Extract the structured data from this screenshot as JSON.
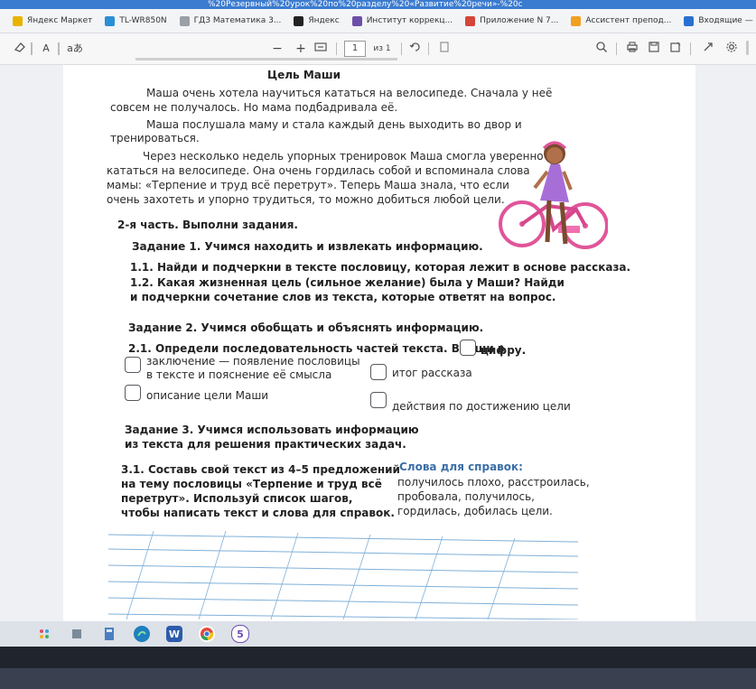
{
  "browser": {
    "url_fragment": "%20Резервный%20урок%20по%20разделу%20«Развитие%20речи»-%20с",
    "bookmarks": [
      {
        "label": "Яндекс Маркет",
        "color": "#e8b400"
      },
      {
        "label": "TL-WR850N",
        "color": "#2a8fd6"
      },
      {
        "label": "ГДЗ Математика 3...",
        "color": "#9aa0a6"
      },
      {
        "label": "Яндекс",
        "color": "#222222"
      },
      {
        "label": "Институт коррекц...",
        "color": "#6b4fa8"
      },
      {
        "label": "Приложение N 7...",
        "color": "#d4453a"
      },
      {
        "label": "Ассистент препод...",
        "color": "#f0a020"
      },
      {
        "label": "Входящие — Рам...",
        "color": "#2b6fd0"
      }
    ]
  },
  "pdf_toolbar": {
    "erase_icon": "eraser-icon",
    "text_size": "A",
    "read_aloud": "aあ",
    "zoom_out": "−",
    "zoom_in": "+",
    "page_current": "1",
    "page_total": "из 1"
  },
  "document": {
    "title": "Цель Маши",
    "p1_l1": "Маша очень хотела научиться кататься на велосипеде. Сначала у неё",
    "p1_l2": "совсем не получалось. Но мама подбадривала её.",
    "p2_l1": "Маша послушала маму и стала каждый день выходить во двор и",
    "p2_l2": "тренироваться.",
    "p3_l1": "Через несколько недель упорных тренировок Маша смогла уверенно",
    "p3_l2": "кататься на велосипеде. Она очень гордилась собой и вспоминала слова",
    "p3_l3": "мамы: «Терпение и труд всё перетрут». Теперь Маша знала, что если",
    "p3_l4": "очень захотеть и упорно трудиться, то можно добиться любой цели.",
    "part2": "2-я часть. Выполни задания.",
    "task1": "Задание 1. Учимся находить и извлекать информацию.",
    "t11": "1.1. Найди и подчеркни в тексте пословицу, которая лежит в основе рассказа.",
    "t12_l1": "1.2. Какая жизненная цель (сильное желание) была у Маши? Найди",
    "t12_l2": "и подчеркни сочетание слов из текста, которые ответят на вопрос.",
    "task2": "Задание 2. Учимся обобщать и объяснять информацию.",
    "t21_a": "2.1. Определи последовательность частей текста. Впиши в",
    "t21_b": "цифру.",
    "opt1_l1": "заключение — появление пословицы",
    "opt1_l2": "в тексте и пояснение её смысла",
    "opt2": "итог рассказа",
    "opt3": "описание цели Маши",
    "opt4": "действия по достижению цели",
    "task3_l1": "Задание 3. Учимся использовать информацию",
    "task3_l2": "из текста для решения практических задач.",
    "t31_l1": "3.1. Составь свой текст из 4–5 предложений",
    "t31_l2": "на тему пословицы «Терпение и труд всё",
    "t31_l3": "перетрут». Используй список шагов,",
    "t31_l4": "чтобы написать текст и слова для справок.",
    "hint_title": "Слова для справок:",
    "hint_l1": "получилось плохо, расстроилась,",
    "hint_l2": "пробовала, получилось,",
    "hint_l3": "гордилась, добилась цели."
  },
  "taskbar": {
    "badge": "5",
    "word_letter": "W"
  }
}
